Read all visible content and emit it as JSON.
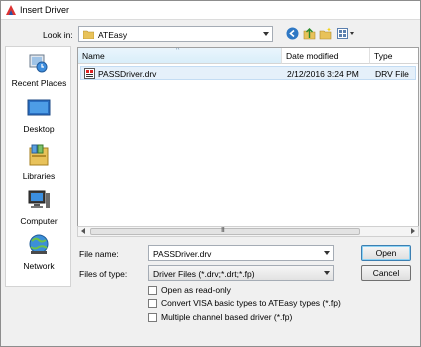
{
  "window": {
    "title": "Insert Driver"
  },
  "lookin": {
    "label": "Look in:",
    "value": "ATEasy"
  },
  "icons": {
    "title": "app-icon",
    "folder": "folder-icon",
    "back": "back-icon",
    "up": "up-folder-icon",
    "newfolder": "new-folder-icon",
    "views": "view-menu-icon",
    "file": "driver-file-icon"
  },
  "places": [
    {
      "label": "Recent Places",
      "icon": "recent-places-icon"
    },
    {
      "label": "Desktop",
      "icon": "desktop-icon"
    },
    {
      "label": "Libraries",
      "icon": "libraries-icon"
    },
    {
      "label": "Computer",
      "icon": "computer-icon"
    },
    {
      "label": "Network",
      "icon": "network-icon"
    }
  ],
  "columns": {
    "name": "Name",
    "date": "Date modified",
    "type": "Type"
  },
  "files": [
    {
      "name": "PASSDriver.drv",
      "date": "2/12/2016 3:24 PM",
      "type": "DRV File"
    }
  ],
  "scrollbar": {
    "grip": "III"
  },
  "filename": {
    "label": "File name:",
    "value": "PASSDriver.drv"
  },
  "filetype": {
    "label": "Files of type:",
    "value": "Driver Files (*.drv;*.drt;*.fp)"
  },
  "buttons": {
    "open": "Open",
    "cancel": "Cancel"
  },
  "options": [
    {
      "label": "Open as read-only",
      "checked": false
    },
    {
      "label": "Convert VISA basic types to ATEasy types (*.fp)",
      "checked": false
    },
    {
      "label": "Multiple channel based driver (*.fp)",
      "checked": false
    }
  ],
  "colors": {
    "selection": "#e5f0fa",
    "dialog": "#f0f0f0",
    "accent": "#3c7fb1"
  }
}
